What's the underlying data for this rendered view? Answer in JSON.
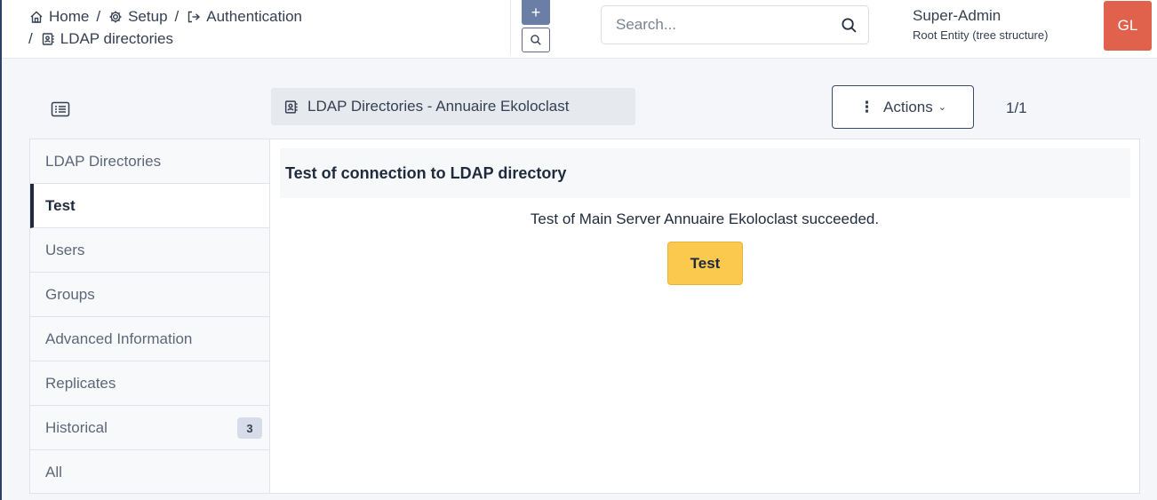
{
  "breadcrumb": {
    "items": [
      {
        "label": "Home",
        "icon": "home-icon"
      },
      {
        "label": "Setup",
        "icon": "gear-icon"
      },
      {
        "label": "Authentication",
        "icon": "sign-in-icon"
      },
      {
        "label": "LDAP directories",
        "icon": "address-book-icon"
      }
    ],
    "separator": "/"
  },
  "header": {
    "add_label": "+",
    "search": {
      "placeholder": "Search..."
    },
    "user": {
      "name": "Super-Admin",
      "entity": "Root Entity (tree structure)",
      "initials": "GL"
    }
  },
  "toolbar": {
    "item_title": "LDAP Directories - Annuaire Ekoloclast",
    "actions_label": "Actions",
    "pager": "1/1"
  },
  "sidebar": {
    "items": [
      {
        "label": "LDAP Directories"
      },
      {
        "label": "Test"
      },
      {
        "label": "Users"
      },
      {
        "label": "Groups"
      },
      {
        "label": "Advanced Information"
      },
      {
        "label": "Replicates"
      },
      {
        "label": "Historical",
        "badge": "3"
      },
      {
        "label": "All"
      }
    ],
    "active": "Test"
  },
  "main": {
    "header": "Test of connection to LDAP directory",
    "message": "Test of Main Server Annuaire Ekoloclast succeeded.",
    "test_button": "Test"
  },
  "colors": {
    "avatar": "#e0624c",
    "test_button": "#fcc94f",
    "add_button": "#6b7ea5"
  }
}
